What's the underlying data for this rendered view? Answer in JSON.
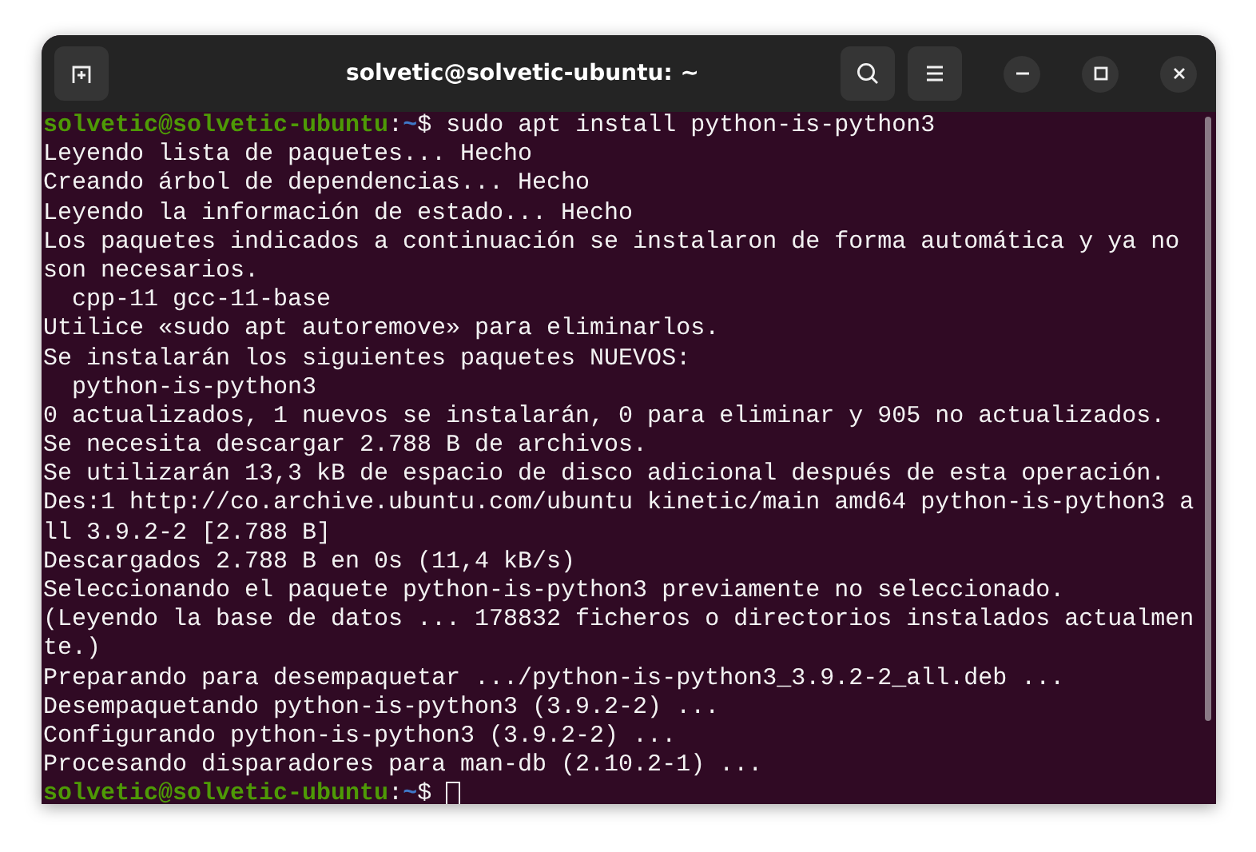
{
  "window": {
    "title": "solvetic@solvetic-ubuntu: ~"
  },
  "terminal": {
    "lines": [
      {
        "kind": "prompt",
        "user": "solvetic@solvetic-ubuntu",
        "separator": ":",
        "path": "~",
        "symbol": "$",
        "command": " sudo apt install python-is-python3",
        "cursor": false
      },
      {
        "kind": "output",
        "text": "Leyendo lista de paquetes... Hecho"
      },
      {
        "kind": "output",
        "text": "Creando árbol de dependencias... Hecho"
      },
      {
        "kind": "output",
        "text": "Leyendo la información de estado... Hecho"
      },
      {
        "kind": "output",
        "text": "Los paquetes indicados a continuación se instalaron de forma automática y ya no"
      },
      {
        "kind": "output",
        "text": "son necesarios."
      },
      {
        "kind": "output",
        "text": "  cpp-11 gcc-11-base"
      },
      {
        "kind": "output",
        "text": "Utilice «sudo apt autoremove» para eliminarlos."
      },
      {
        "kind": "output",
        "text": "Se instalarán los siguientes paquetes NUEVOS:"
      },
      {
        "kind": "output",
        "text": "  python-is-python3"
      },
      {
        "kind": "output",
        "text": "0 actualizados, 1 nuevos se instalarán, 0 para eliminar y 905 no actualizados."
      },
      {
        "kind": "output",
        "text": "Se necesita descargar 2.788 B de archivos."
      },
      {
        "kind": "output",
        "text": "Se utilizarán 13,3 kB de espacio de disco adicional después de esta operación."
      },
      {
        "kind": "output",
        "text": "Des:1 http://co.archive.ubuntu.com/ubuntu kinetic/main amd64 python-is-python3 a"
      },
      {
        "kind": "output",
        "text": "ll 3.9.2-2 [2.788 B]"
      },
      {
        "kind": "output",
        "text": "Descargados 2.788 B en 0s (11,4 kB/s)"
      },
      {
        "kind": "output",
        "text": "Seleccionando el paquete python-is-python3 previamente no seleccionado."
      },
      {
        "kind": "output",
        "text": "(Leyendo la base de datos ... 178832 ficheros o directorios instalados actualmen"
      },
      {
        "kind": "output",
        "text": "te.)"
      },
      {
        "kind": "output",
        "text": "Preparando para desempaquetar .../python-is-python3_3.9.2-2_all.deb ..."
      },
      {
        "kind": "output",
        "text": "Desempaquetando python-is-python3 (3.9.2-2) ..."
      },
      {
        "kind": "output",
        "text": "Configurando python-is-python3 (3.9.2-2) ..."
      },
      {
        "kind": "output",
        "text": "Procesando disparadores para man-db (2.10.2-1) ..."
      },
      {
        "kind": "prompt",
        "user": "solvetic@solvetic-ubuntu",
        "separator": ":",
        "path": "~",
        "symbol": "$",
        "cursor": true
      }
    ]
  }
}
